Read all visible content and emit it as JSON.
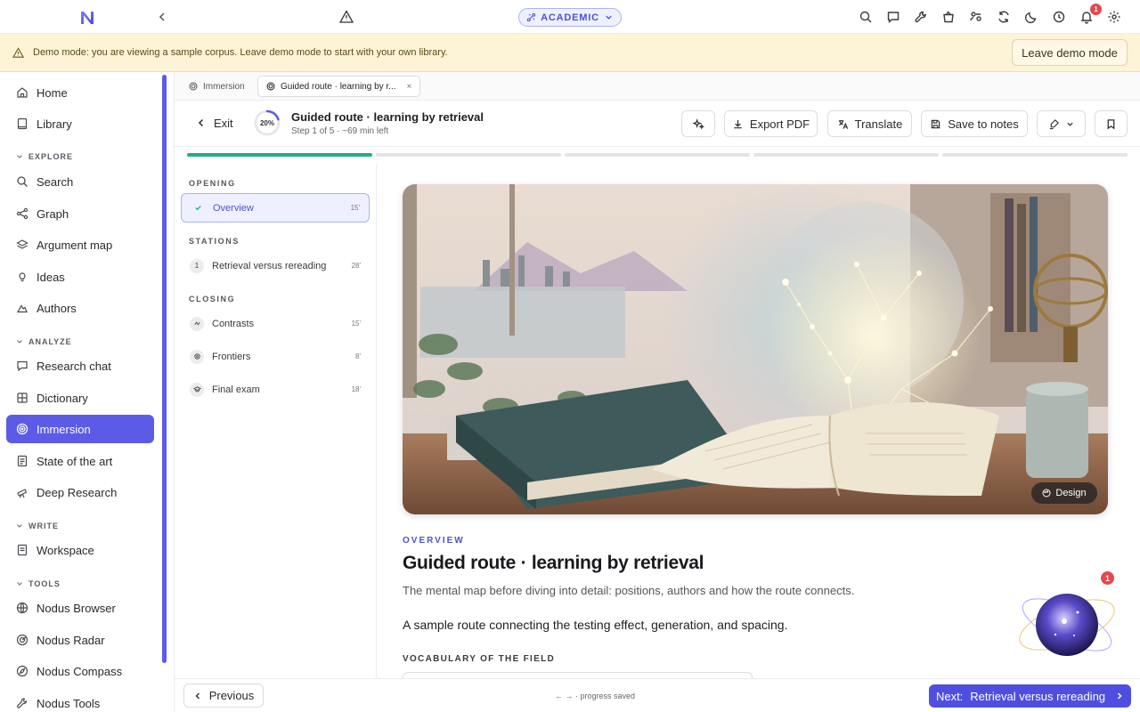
{
  "topbar": {
    "logo": "nodus-logo",
    "mode": "ACADEMIC",
    "notification_count": "1",
    "icons": [
      "search-icon",
      "chat-icon",
      "wrench-icon",
      "bag-icon",
      "users-icon",
      "sync-icon",
      "moon-icon",
      "clock-icon",
      "bell-icon",
      "gear-icon"
    ]
  },
  "banner": {
    "text": "Demo mode: you are viewing a sample corpus. Leave demo mode to start with your own library.",
    "button": "Leave demo mode"
  },
  "sidebar": {
    "top_items": [
      {
        "label": "Home",
        "icon": "home-icon"
      },
      {
        "label": "Library",
        "icon": "book-icon"
      }
    ],
    "sections": [
      {
        "title": "EXPLORE",
        "items": [
          {
            "label": "Search",
            "icon": "search-icon"
          },
          {
            "label": "Graph",
            "icon": "graph-icon"
          },
          {
            "label": "Argument map",
            "icon": "layers-icon"
          },
          {
            "label": "Ideas",
            "icon": "bulb-icon"
          },
          {
            "label": "Authors",
            "icon": "authors-icon"
          }
        ]
      },
      {
        "title": "ANALYZE",
        "items": [
          {
            "label": "Research chat",
            "icon": "chat-icon"
          },
          {
            "label": "Dictionary",
            "icon": "dictionary-icon"
          },
          {
            "label": "Immersion",
            "icon": "target-icon",
            "active": true
          },
          {
            "label": "State of the art",
            "icon": "document-icon"
          },
          {
            "label": "Deep Research",
            "icon": "telescope-icon"
          }
        ]
      },
      {
        "title": "WRITE",
        "items": [
          {
            "label": "Workspace",
            "icon": "document-icon"
          }
        ]
      },
      {
        "title": "TOOLS",
        "items": [
          {
            "label": "Nodus Browser",
            "icon": "globe-icon"
          },
          {
            "label": "Nodus Radar",
            "icon": "radar-icon"
          },
          {
            "label": "Nodus Compass",
            "icon": "compass-icon"
          },
          {
            "label": "Nodus Tools",
            "icon": "wrench-icon"
          }
        ]
      }
    ]
  },
  "tabs": [
    {
      "label": "Immersion",
      "active": false
    },
    {
      "label": "Guided route · learning by r...",
      "active": true,
      "close": "×"
    }
  ],
  "route": {
    "exit": "Exit",
    "progress_label": "20%",
    "progress": 0.2,
    "title": "Guided route · learning by retrieval",
    "subtitle": "Step 1 of 5 · ~69 min left",
    "buttons": {
      "export": "Export PDF",
      "translate": "Translate",
      "save": "Save to notes"
    }
  },
  "progress_segments": {
    "total": 5,
    "done": 1
  },
  "steps": {
    "sections": [
      {
        "title": "OPENING",
        "items": [
          {
            "badge": "✓",
            "label": "Overview",
            "duration": "15'",
            "active": true
          }
        ]
      },
      {
        "title": "STATIONS",
        "items": [
          {
            "badge": "1",
            "label": "Retrieval versus rereading",
            "duration": "28'"
          }
        ]
      },
      {
        "title": "CLOSING",
        "items": [
          {
            "badge": "contrast-icon",
            "label": "Contrasts",
            "duration": "15'"
          },
          {
            "badge": "frontier-icon",
            "label": "Frontiers",
            "duration": "8'"
          },
          {
            "badge": "cap-icon",
            "label": "Final exam",
            "duration": "18'"
          }
        ]
      }
    ]
  },
  "content": {
    "design_button": "Design",
    "kicker": "OVERVIEW",
    "title": "Guided route · learning by retrieval",
    "subtitle": "The mental map before diving into detail: positions, authors and how the route connects.",
    "summary": "A sample route connecting the testing effect, generation, and spacing.",
    "vocab_heading": "VOCABULARY OF THE FIELD"
  },
  "assistant": {
    "badge": "1"
  },
  "footer": {
    "previous": "Previous",
    "hint": "← → · progress saved",
    "next_prefix": "Next:",
    "next_label": "Retrieval versus rereading"
  },
  "colors": {
    "accent": "#5b5be8",
    "success": "#22b07d",
    "banner": "#fdf3d6",
    "danger": "#e5484d"
  }
}
